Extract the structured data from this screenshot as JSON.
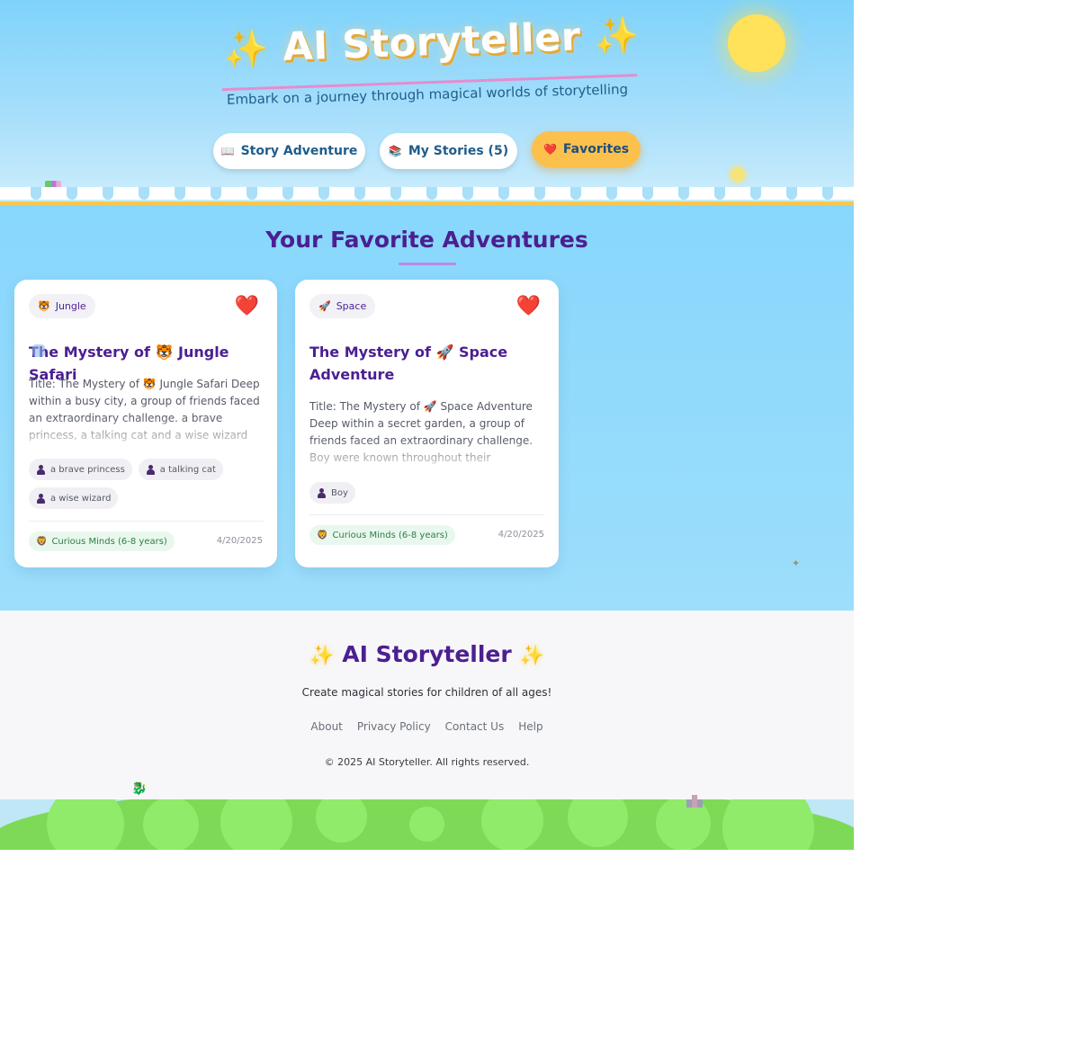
{
  "header": {
    "title": "AI Storyteller",
    "sparkle_left": "✨",
    "sparkle_right": "✨",
    "subtitle": "Embark on a journey through magical worlds of storytelling",
    "nav": [
      {
        "icon": "📖",
        "label": "Story Adventure",
        "active": false
      },
      {
        "icon": "📚",
        "label": "My Stories (5)",
        "active": false
      },
      {
        "icon": "❤️",
        "label": "Favorites",
        "active": true
      }
    ]
  },
  "main": {
    "section_title": "Your Favorite Adventures",
    "cards": [
      {
        "category_icon": "🐯",
        "category": "Jungle",
        "favorite_icon": "❤️",
        "title": "The Mystery of 🐯 Jungle Safari",
        "excerpt": "Title: The Mystery of 🐯 Jungle Safari Deep within a busy city, a group of friends faced an extraordinary challenge. a brave princess, a talking cat and a wise wizard were known throughout their community for",
        "characters": [
          "a brave princess",
          "a talking cat",
          "a wise wizard"
        ],
        "age_icon": "🦁",
        "age_group": "Curious Minds (6-8 years)",
        "date": "4/20/2025"
      },
      {
        "category_icon": "🚀",
        "category": "Space",
        "favorite_icon": "❤️",
        "title": "The Mystery of 🚀 Space Adventure",
        "excerpt": "Title: The Mystery of 🚀 Space Adventure Deep within a secret garden, a group of friends faced an extraordinary challenge. Boy were known throughout their community for their courage",
        "characters": [
          "Boy"
        ],
        "age_icon": "🦁",
        "age_group": "Curious Minds (6-8 years)",
        "date": "4/20/2025"
      }
    ]
  },
  "footer": {
    "title": "AI Storyteller",
    "sparkle": "✨",
    "tagline": "Create magical stories for children of all ages!",
    "links": [
      "About",
      "Privacy Policy",
      "Contact Us",
      "Help"
    ],
    "copyright": "© 2025 AI Storyteller. All rights reserved."
  },
  "icons": {
    "favorite": "heart-icon",
    "character": "person-icon",
    "age": "lion-icon",
    "sun": "sun-icon"
  },
  "colors": {
    "primary_purple": "#4b1f91",
    "sky_blue": "#7dd3fc",
    "active_tab": "#fcc04c",
    "heart_red": "#e3203c",
    "grass_green": "#7ed957"
  }
}
